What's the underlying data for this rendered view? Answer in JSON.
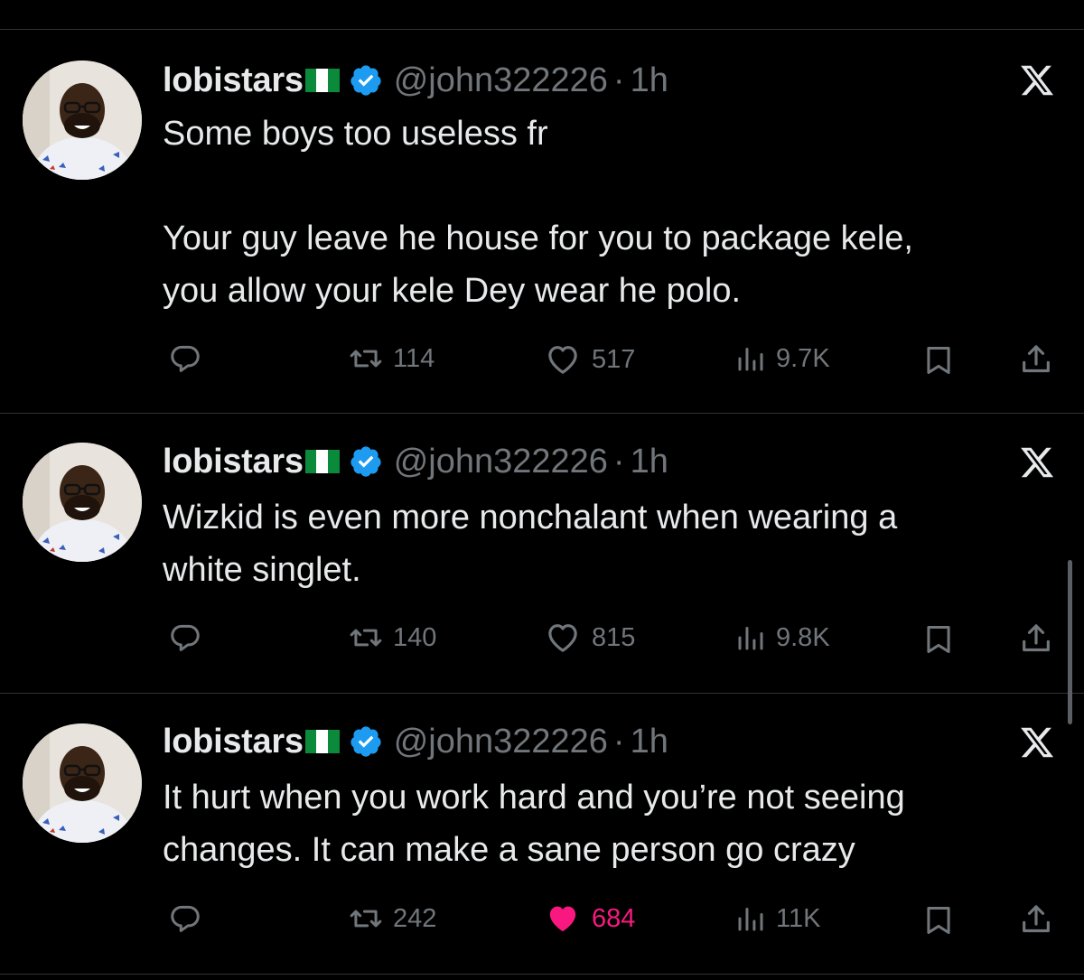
{
  "colors": {
    "background": "#000000",
    "text": "#e7e9ea",
    "muted": "#71767b",
    "verified": "#1d9bf0",
    "like_active": "#f91880"
  },
  "tweets": [
    {
      "name": "lobistars",
      "flag": "nigeria-flag",
      "handle": "@john322226",
      "separator": "·",
      "time": "1h",
      "text": "Some boys too useless fr\n\nYour guy leave he house for you to package kele,\nyou allow your kele Dey wear he polo.",
      "replies": "",
      "reposts": "114",
      "likes": "517",
      "liked": false,
      "views": "9.7K"
    },
    {
      "name": "lobistars",
      "flag": "nigeria-flag",
      "handle": "@john322226",
      "separator": "·",
      "time": "1h",
      "text": "Wizkid is even more nonchalant when wearing a\nwhite singlet.",
      "replies": "",
      "reposts": "140",
      "likes": "815",
      "liked": false,
      "views": "9.8K"
    },
    {
      "name": "lobistars",
      "flag": "nigeria-flag",
      "handle": "@john322226",
      "separator": "·",
      "time": "1h",
      "text": "It hurt when you work hard and you’re not seeing\nchanges. It can make a sane person go crazy",
      "replies": "",
      "reposts": "242",
      "likes": "684",
      "liked": true,
      "views": "11K"
    }
  ]
}
